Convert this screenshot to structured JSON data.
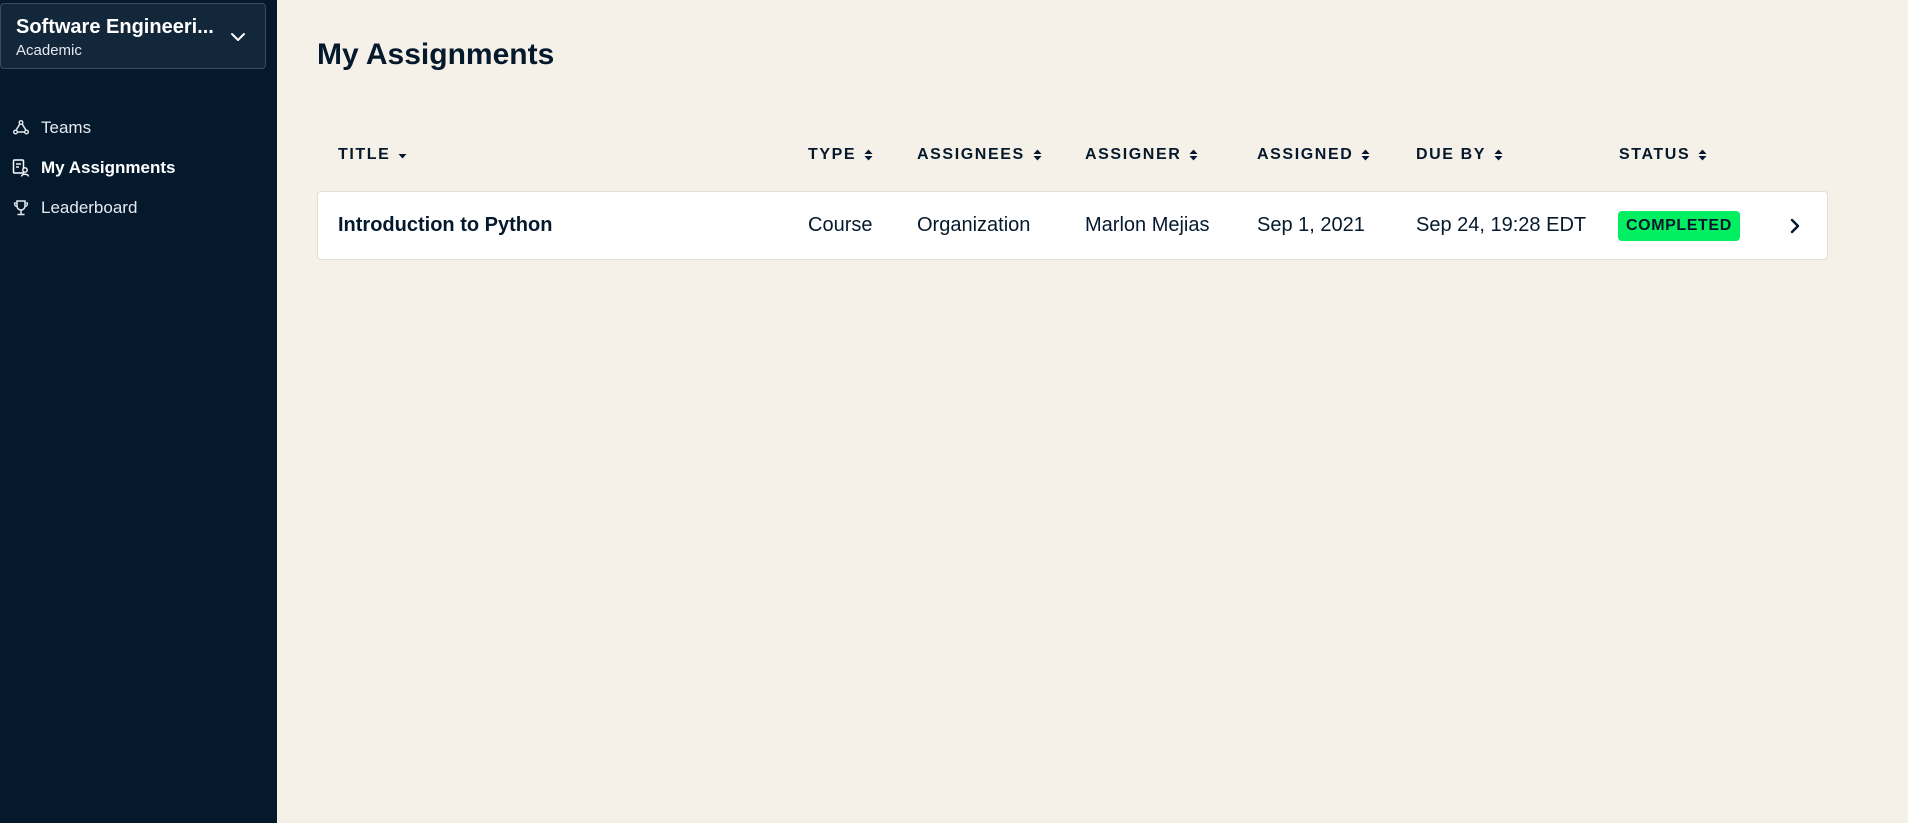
{
  "sidebar": {
    "org_name": "Software Engineeri...",
    "org_type": "Academic",
    "items": [
      {
        "label": "Teams",
        "icon": "teams-icon",
        "active": false
      },
      {
        "label": "My Assignments",
        "icon": "assignments-icon",
        "active": true
      },
      {
        "label": "Leaderboard",
        "icon": "trophy-icon",
        "active": false
      }
    ]
  },
  "main": {
    "title": "My Assignments",
    "columns": [
      "TITLE",
      "TYPE",
      "ASSIGNEES",
      "ASSIGNER",
      "ASSIGNED",
      "DUE BY",
      "STATUS"
    ],
    "sorted_column": "TITLE",
    "rows": [
      {
        "title": "Introduction to Python",
        "type": "Course",
        "assignees": "Organization",
        "assigner": "Marlon Mejias",
        "assigned": "Sep 1, 2021",
        "due_by": "Sep 24, 19:28 EDT",
        "status": "COMPLETED"
      }
    ]
  },
  "colors": {
    "sidebar_bg": "#05192d",
    "page_bg": "#f5f0e8",
    "status_completed": "#03ef62"
  }
}
